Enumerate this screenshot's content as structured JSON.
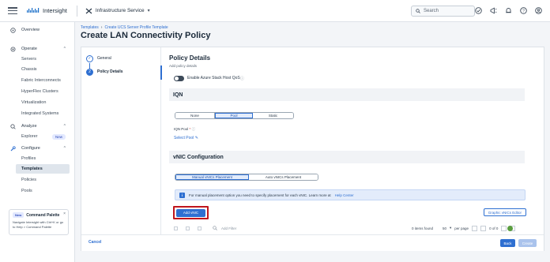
{
  "topbar": {
    "app_name": "Intersight",
    "service": "Infrastructure Service",
    "search_placeholder": "Search"
  },
  "sidebar": {
    "overview": "Overview",
    "operate": "Operate",
    "operate_items": [
      "Servers",
      "Chassis",
      "Fabric Interconnects",
      "HyperFlex Clusters",
      "Virtualization",
      "Integrated Systems"
    ],
    "analyze": "Analyze",
    "explorer": "Explorer",
    "new_badge": "New",
    "configure": "Configure",
    "configure_items": [
      "Profiles",
      "Templates",
      "Policies",
      "Pools"
    ],
    "palette": {
      "badge": "New",
      "title": "Command Palette",
      "body": "Navigate Intersight with Ctrl+K or go to Help > Command Palette"
    }
  },
  "header": {
    "breadcrumb": [
      "Templates",
      "Create UCS Server Profile Template"
    ],
    "title": "Create LAN Connectivity Policy"
  },
  "steps": [
    {
      "label": "General",
      "marker": "✓"
    },
    {
      "label": "Policy Details",
      "marker": "2"
    }
  ],
  "details": {
    "title": "Policy Details",
    "subtitle": "Add policy details",
    "toggle_label": "Enable Azure Stack Host QoS",
    "iqn_section": "IQN",
    "iqn_options": [
      "None",
      "Pool",
      "Static"
    ],
    "iqn_selected": "Pool",
    "iqn_pool_label": "IQN Pool",
    "select_pool": "Select Pool",
    "vnic_section": "vNIC Configuration",
    "placement_options": [
      "Manual vNICs Placement",
      "Auto vNICs Placement"
    ],
    "placement_selected": "Manual vNICs Placement",
    "banner_text": "For manual placement option you need to specify placement for each vNIC. Learn more at",
    "banner_link": "Help Center",
    "add_vnic": "Add vNIC",
    "graphic_editor": "Graphic vNICs Editor",
    "add_filter": "Add Filter",
    "items_found": "0 items found",
    "per_page_value": "50",
    "per_page": "per page",
    "page_of": "0 of 0"
  },
  "footer": {
    "cancel": "Cancel",
    "back": "Back",
    "create": "Create"
  },
  "colors": {
    "accent": "#2e6fd1",
    "highlight": "#c0161d"
  }
}
